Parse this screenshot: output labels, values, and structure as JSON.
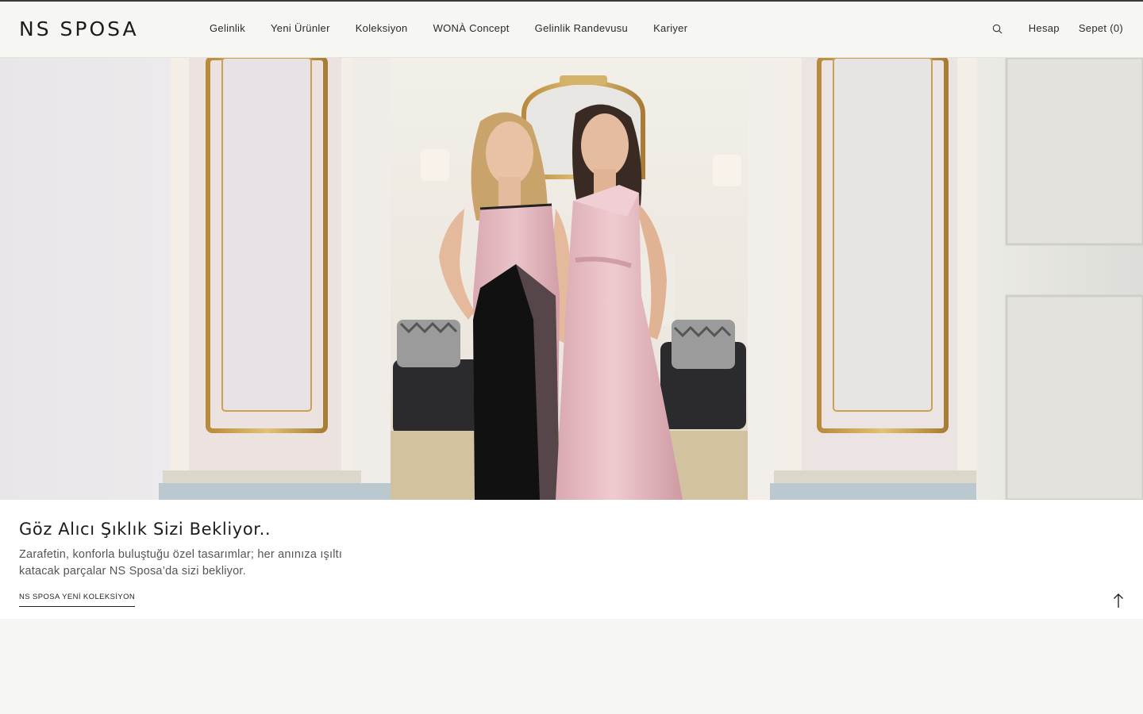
{
  "brand": {
    "logo_text": "NS SPOSA"
  },
  "nav": {
    "items": [
      {
        "label": "Gelinlik"
      },
      {
        "label": "Yeni Ürünler"
      },
      {
        "label": "Koleksiyon"
      },
      {
        "label": "WONÀ Concept"
      },
      {
        "label": "Gelinlik Randevusu"
      },
      {
        "label": "Kariyer"
      }
    ]
  },
  "header_right": {
    "search_icon": "search-icon",
    "account_label": "Hesap",
    "cart_label": "Sepet (0)"
  },
  "hero": {
    "image_description_icon": "hero-photo",
    "title": "Göz Alıcı Şıklık Sizi Bekliyor..",
    "description": "Zarafetin, konforla buluştuğu özel tasarımlar; her anınıza ışıltı katacak parçalar NS Sposa’da sizi bekliyor.",
    "cta_label": "NS SPOSA YENİ KOLEKSİYON"
  },
  "scroll_top_icon": "arrow-up-icon",
  "colors": {
    "background": "#f6f6f2",
    "text": "#1a1a1a",
    "dress_pink": "#e2b8bf",
    "gold_trim": "#c9a253"
  }
}
